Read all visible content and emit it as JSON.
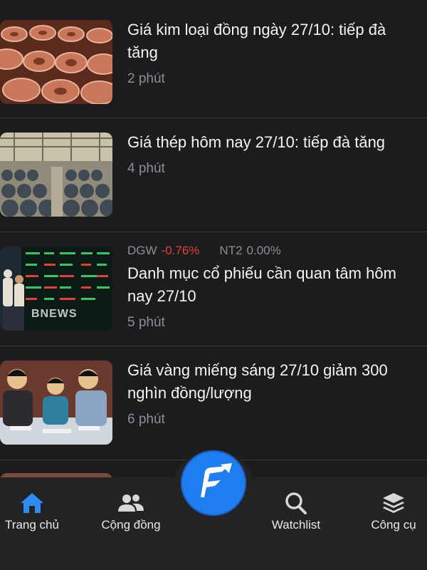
{
  "articles": [
    {
      "headline": "Giá kim loại đồng ngày 27/10: tiếp đà\ntăng",
      "time": "2 phút",
      "image_icon": "copper-coils-image"
    },
    {
      "headline": "Giá thép hôm nay 27/10: tiếp đà tăng",
      "time": "4 phút",
      "image_icon": "steel-coils-warehouse-image"
    },
    {
      "tickers": [
        {
          "symbol": "DGW",
          "change": "-0.76%",
          "color": "#e0413a"
        },
        {
          "symbol": "NT2",
          "change": "0.00%",
          "color": "#8e8e93"
        }
      ],
      "headline": "Danh mục cổ phiếu cần quan tâm hôm\nnay 27/10",
      "time": "5 phút",
      "image_icon": "stock-board-image",
      "watermark": "BNEWS"
    },
    {
      "headline": "Giá vàng miếng sáng 27/10 giảm 300\nnghìn đồng/lượng",
      "time": "6 phút",
      "image_icon": "gold-shop-customers-image"
    }
  ],
  "tabbar": {
    "items": [
      {
        "label": "Trang chủ",
        "icon": "home-icon",
        "active": true
      },
      {
        "label": "Cộng đồng",
        "icon": "community-icon",
        "active": false
      },
      {
        "label": "Watchlist",
        "icon": "search-icon",
        "active": false
      },
      {
        "label": "Công cụ",
        "icon": "layers-icon",
        "active": false
      }
    ],
    "center_button_icon": "app-logo-icon"
  },
  "colors": {
    "background": "#1c1c1e",
    "accent": "#1e7df0",
    "active_tab": "#2d8cf0",
    "negative": "#e0413a",
    "muted": "#8e8e93"
  }
}
